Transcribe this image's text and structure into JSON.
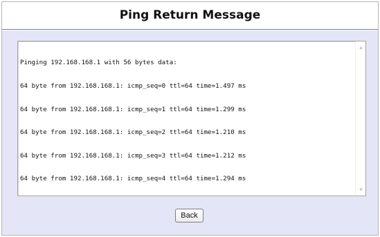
{
  "page": {
    "title": "Ping Return Message"
  },
  "output": {
    "lines": [
      "Pinging 192.168.168.1 with 56 bytes data:",
      "64 byte from 192.168.168.1: icmp_seq=0 ttl=64 time=1.497 ms",
      "64 byte from 192.168.168.1: icmp_seq=1 ttl=64 time=1.299 ms",
      "64 byte from 192.168.168.1: icmp_seq=2 ttl=64 time=1.210 ms",
      "64 byte from 192.168.168.1: icmp_seq=3 ttl=64 time=1.212 ms",
      "64 byte from 192.168.168.1: icmp_seq=4 ttl=64 time=1.294 ms"
    ]
  },
  "actions": {
    "back_label": "Back"
  },
  "icons": {
    "scroll_up": "chevron-up-icon",
    "scroll_down": "chevron-down-icon"
  },
  "colors": {
    "panel_background": "#e4e6f7",
    "border": "#7a7a9c"
  }
}
